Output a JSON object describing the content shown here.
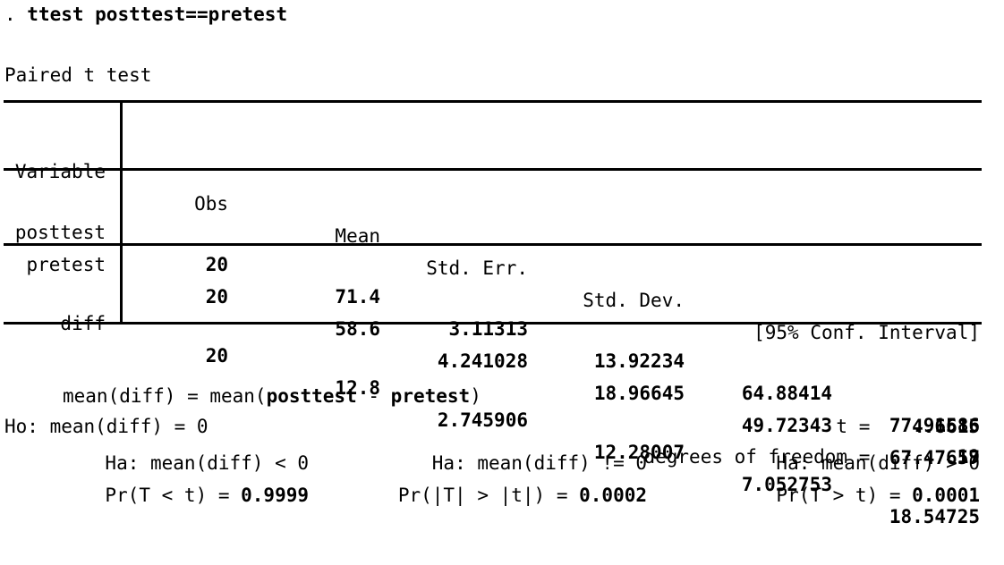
{
  "console": {
    "prompt": ". ",
    "command": "ttest posttest==pretest",
    "test_title": "Paired t test"
  },
  "table": {
    "headers": {
      "variable": "Variable",
      "obs": "Obs",
      "mean": "Mean",
      "std_err": "Std. Err.",
      "std_dev": "Std. Dev.",
      "conf_interval": "[95% Conf. Interval]"
    },
    "rows": [
      {
        "variable": "posttest",
        "obs": "20",
        "mean": "71.4",
        "std_err": "3.11313",
        "std_dev": "13.92234",
        "ci_low": "64.88414",
        "ci_high": "77.91586"
      },
      {
        "variable": "pretest",
        "obs": "20",
        "mean": "58.6",
        "std_err": "4.241028",
        "std_dev": "18.96645",
        "ci_low": "49.72343",
        "ci_high": "67.47657"
      }
    ],
    "diff_row": {
      "variable": "diff",
      "obs": "20",
      "mean": "12.8",
      "std_err": "2.745906",
      "std_dev": "12.28007",
      "ci_low": "7.052753",
      "ci_high": "18.54725"
    }
  },
  "summary": {
    "mean_def_prefix": "mean(diff) = mean(",
    "mean_def_var1": "posttest",
    "mean_def_operator": " - ",
    "mean_def_var2": "pretest",
    "mean_def_suffix": ")",
    "null_hypothesis": "Ho: mean(diff) = 0",
    "t_label": "t = ",
    "t_value": "4.6615",
    "df_label": "degrees of freedom = ",
    "df_value": "19"
  },
  "hypotheses": [
    {
      "alternative": "Ha: mean(diff) < 0",
      "pr_label": "Pr(T < t) = ",
      "pr_value": "0.9999"
    },
    {
      "alternative": "Ha: mean(diff) != 0",
      "pr_label": "Pr(|T| > |t|) = ",
      "pr_value": "0.0002"
    },
    {
      "alternative": "Ha: mean(diff) > 0",
      "pr_label": "Pr(T > t) = ",
      "pr_value": "0.0001"
    }
  ],
  "colors": {
    "background": "#ffffff",
    "text": "#000000",
    "rule": "#000000"
  }
}
